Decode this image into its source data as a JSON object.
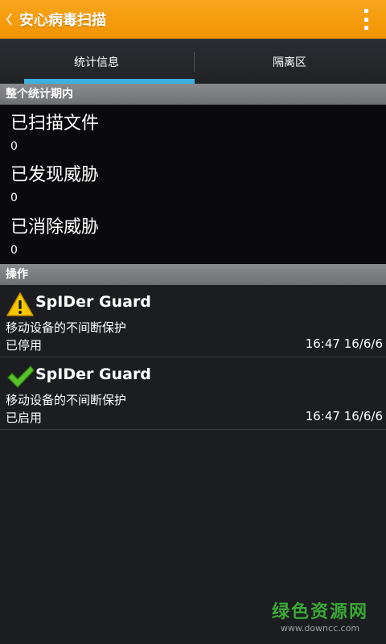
{
  "appbar": {
    "title": "安心病毒扫描"
  },
  "tabs": [
    {
      "label": "统计信息",
      "selected": true
    },
    {
      "label": "隔离区",
      "selected": false
    }
  ],
  "stats_section": {
    "header": "整个统计期内",
    "items": [
      {
        "label": "已扫描文件",
        "value": "0"
      },
      {
        "label": "已发现威胁",
        "value": "0"
      },
      {
        "label": "已消除威胁",
        "value": "0"
      }
    ]
  },
  "ops_section": {
    "header": "操作",
    "items": [
      {
        "icon": "warning-icon",
        "title": "SpIDer Guard",
        "desc": "移动设备的不间断保护",
        "status": "已停用",
        "time": "16:47 16/6/6"
      },
      {
        "icon": "checkmark-icon",
        "title": "SpIDer Guard",
        "desc": "移动设备的不间断保护",
        "status": "已启用",
        "time": "16:47 16/6/6"
      }
    ]
  },
  "watermark": {
    "main": "绿色资源网",
    "url": "www.downcc.com"
  },
  "colors": {
    "appbar": "#f39400",
    "tab_indicator": "#3bb1de",
    "section_header": "#7c7d81"
  }
}
